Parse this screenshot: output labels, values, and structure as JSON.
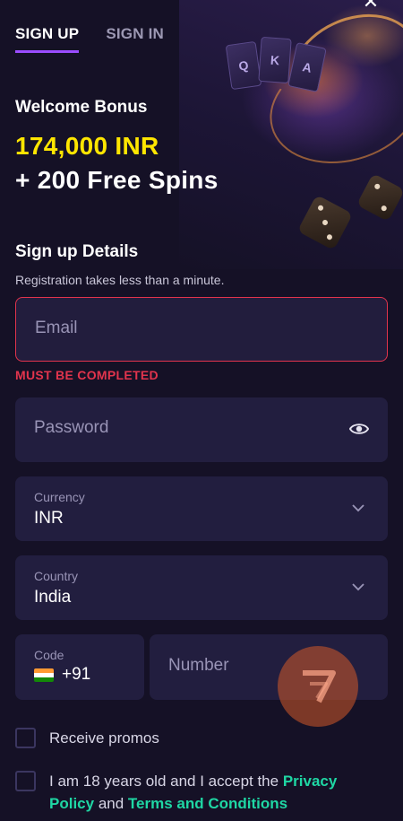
{
  "tabs": [
    {
      "label": "SIGN UP",
      "active": true
    },
    {
      "label": "SIGN IN",
      "active": false
    }
  ],
  "bonus": {
    "label": "Welcome Bonus",
    "amount": "174,000 INR",
    "spins": "+ 200 Free Spins"
  },
  "form": {
    "title": "Sign up Details",
    "subtitle": "Registration takes less than a minute.",
    "email": {
      "placeholder": "Email",
      "error": "MUST BE COMPLETED"
    },
    "password": {
      "placeholder": "Password"
    },
    "currency": {
      "label": "Currency",
      "value": "INR"
    },
    "country": {
      "label": "Country",
      "value": "India"
    },
    "phone": {
      "code_label": "Code",
      "code_value": "+91",
      "number_placeholder": "Number"
    },
    "promos_label": "Receive promos",
    "terms": {
      "prefix": "I am 18 years old and I accept the ",
      "privacy_link": "Privacy Policy",
      "conjunction": " and ",
      "terms_link": "Terms and Conditions"
    }
  },
  "colors": {
    "background": "#151126",
    "field": "#221e3f",
    "accent_tab": "#9b4dff",
    "bonus_yellow": "#ffe600",
    "error": "#e2344d",
    "link": "#1fd7a4"
  },
  "icons": {
    "close": "close-icon",
    "eye": "eye-icon",
    "chevron": "chevron-down-icon",
    "flag": "india-flag-icon"
  }
}
